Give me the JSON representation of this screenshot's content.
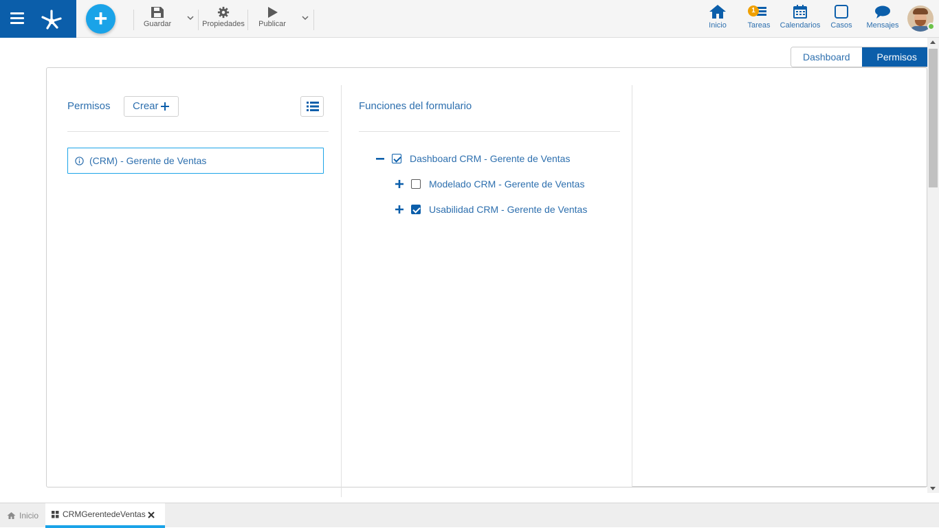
{
  "toolbar": {
    "add_label": "+",
    "save_label": "Guardar",
    "properties_label": "Propiedades",
    "publish_label": "Publicar"
  },
  "nav": {
    "home_label": "Inicio",
    "tasks_label": "Tareas",
    "tasks_badge": "1",
    "calendars_label": "Calendarios",
    "cases_label": "Casos",
    "messages_label": "Mensajes"
  },
  "view_tabs": {
    "dashboard": "Dashboard",
    "permissions": "Permisos",
    "active": "Permisos"
  },
  "permissions_panel": {
    "title": "Permisos",
    "create_label": "Crear",
    "items": [
      {
        "label": "(CRM) - Gerente de Ventas"
      }
    ]
  },
  "functions_panel": {
    "title": "Funciones del formulario",
    "tree": [
      {
        "label": "Dashboard CRM - Gerente de Ventas",
        "expanded": true,
        "checked": true
      },
      {
        "label": "Modelado CRM - Gerente de Ventas",
        "expanded": false,
        "checked": false
      },
      {
        "label": "Usabilidad CRM - Gerente de Ventas",
        "expanded": false,
        "checked": true
      }
    ]
  },
  "bottom_tabs": {
    "home_label": "Inicio",
    "doc_label": "CRMGerentedeVentas"
  },
  "colors": {
    "brand": "#0b5eaa",
    "accent": "#1aa3e8",
    "text_blue": "#2d6fae",
    "badge": "#f0a000"
  }
}
